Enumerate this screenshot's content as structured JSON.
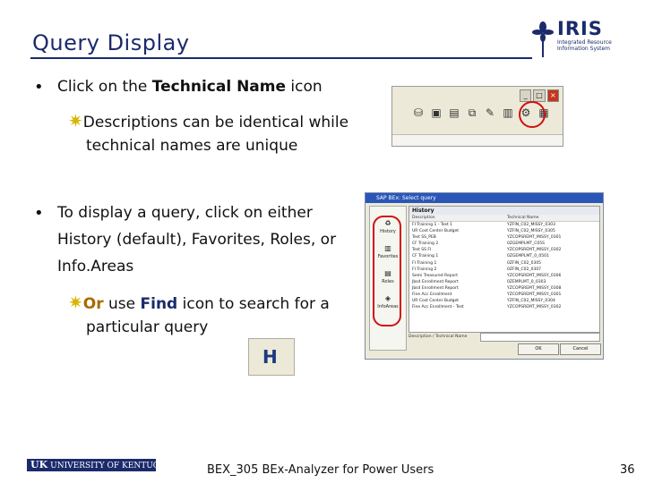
{
  "slide": {
    "title": "Query Display",
    "logo": {
      "word": "IRIS",
      "subtitle": "Integrated Resource Information System"
    },
    "bullet_glyph": "•",
    "star_glyph": "✷",
    "bullets": [
      {
        "pre": "Click on the ",
        "bold": "Technical Name",
        "post": " icon",
        "sub": {
          "line1": "Descriptions can be identical while",
          "line2": "technical names are unique"
        }
      },
      {
        "lines": [
          "To display a query, click on either",
          "History (default), Favorites, Roles, or",
          "Info.Areas"
        ],
        "sub": {
          "or": "Or",
          "pre": " use ",
          "find": "Find",
          "post": "  icon to search for a",
          "line2": "particular query"
        }
      }
    ],
    "footer": {
      "logo_prefix": "UK",
      "logo_text": "UNIVERSITY OF KENTUCKY",
      "text": "BEX_305 BEx-Analyzer for Power Users",
      "page": "36"
    }
  },
  "toolbar_shot": {
    "window_buttons": [
      "_",
      "□",
      "×"
    ],
    "icons": [
      "binoculars-icon",
      "new-icon",
      "folder-icon",
      "link-icon",
      "edit-icon",
      "trash-icon",
      "tech-name-icon",
      "details-icon"
    ]
  },
  "dialog_shot": {
    "title": "SAP BEx: Select query",
    "side_items": [
      "History",
      "Favorites",
      "Roles",
      "InfoAreas"
    ],
    "header": "History",
    "columns": [
      "Description",
      "Technical Name"
    ],
    "rows": [
      [
        "FI Training 1 - Test 1",
        "YZFIN_C02_MISSY_0303"
      ],
      [
        "UR Cost Center Budget",
        "YZFIN_C02_MISSY_0305"
      ],
      [
        "Test SS_PEB",
        "YZCOPSREMT_MISSY_0301"
      ],
      [
        "CF Training 2",
        "0ZGEMPLMT_C05S"
      ],
      [
        "Test SS FI",
        "YZCOPSREMT_MISSY_0302"
      ],
      [
        "CF Training 1",
        "0ZGEMPLMT_0_0501"
      ],
      [
        "FI Training 1",
        "0ZFIN_C02_0305"
      ],
      [
        "FI Training 2",
        "0ZFIN_C02_0307"
      ],
      [
        "Semi Treasured Report",
        "YZCOPSREMT_MISSY_0306"
      ],
      [
        "Jbsd Enrollment Report",
        "0ZEMPLMT_0_0303"
      ],
      [
        "Jbsd Enrollment Report",
        "YZCOPSREMT_MISSY_0308"
      ],
      [
        "Fine Acc Enrollment",
        "YZCOPSREMT_MISSY_0301"
      ],
      [
        "UR Cost Center Budget",
        "YZFIN_C02_MISSY_0304"
      ],
      [
        "Fine Acc Enrollment - Test",
        "YZCOPSREMT_MISSY_0302"
      ]
    ],
    "field_label": "Description / Technical Name",
    "buttons": [
      "OK",
      "Cancel"
    ]
  },
  "find_icon": {
    "glyph": "H"
  }
}
